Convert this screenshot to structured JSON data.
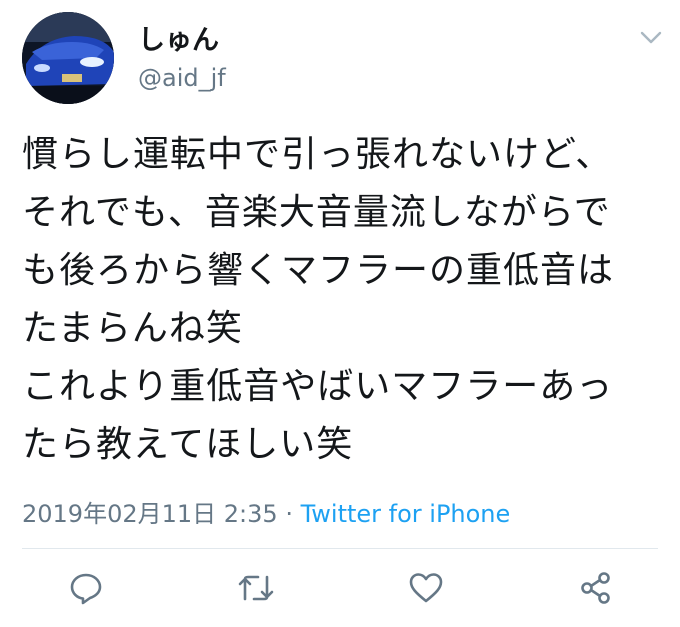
{
  "user": {
    "display_name": "しゅん",
    "handle": "@aid_jf"
  },
  "tweet": {
    "lines": [
      "慣らし運転中で引っ張れないけど、",
      "それでも、音楽大音量流しながらで",
      "も後ろから響くマフラーの重低音は",
      "たまらんね笑",
      "これより重低音やばいマフラーあっ",
      "たら教えてほしい笑"
    ],
    "timestamp": "2019年02月11日 2:35",
    "separator": " · ",
    "source": "Twitter for iPhone"
  },
  "actions": [
    "reply-icon",
    "retweet-icon",
    "like-icon",
    "share-icon"
  ],
  "colors": {
    "text": "#14171a",
    "muted": "#657786",
    "link": "#1da1f2",
    "divider": "#e1e8ed"
  }
}
